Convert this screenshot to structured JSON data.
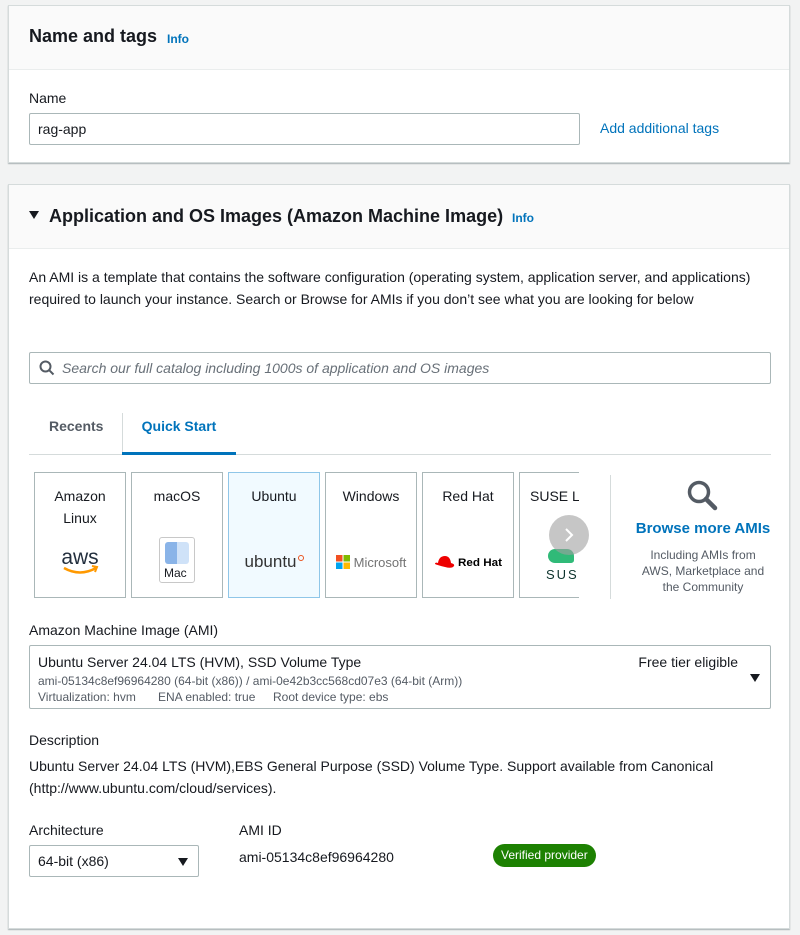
{
  "name_tags": {
    "title": "Name and tags",
    "info": "Info",
    "name_label": "Name",
    "name_value": "rag-app",
    "add_tags": "Add additional tags"
  },
  "ami_section": {
    "title": "Application and OS Images (Amazon Machine Image)",
    "info": "Info",
    "description": "An AMI is a template that contains the software configuration (operating system, application server, and applications) required to launch your instance. Search or Browse for AMIs if you don’t see what you are looking for below",
    "search_placeholder": "Search our full catalog including 1000s of application and OS images",
    "tabs": [
      "Recents",
      "Quick Start"
    ],
    "active_tab": "Quick Start",
    "os_cards": [
      {
        "label": "Amazon Linux",
        "logo": "aws"
      },
      {
        "label": "macOS",
        "logo": "Mac"
      },
      {
        "label": "Ubuntu",
        "logo": "ubuntu",
        "selected": true
      },
      {
        "label": "Windows",
        "logo": "Microsoft"
      },
      {
        "label": "Red Hat",
        "logo": "Red Hat"
      },
      {
        "label": "SUSE Li",
        "logo": "SUSE"
      }
    ],
    "browse_more": {
      "title": "Browse more AMIs",
      "subtitle": "Including AMIs from AWS, Marketplace and the Community"
    },
    "ami_label": "Amazon Machine Image (AMI)",
    "ami_select": {
      "name": "Ubuntu Server 24.04 LTS (HVM), SSD Volume Type",
      "free_tier": "Free tier eligible",
      "ids": "ami-05134c8ef96964280 (64-bit (x86)) / ami-0e42b3cc568cd07e3 (64-bit (Arm))",
      "virtualization": "Virtualization: hvm",
      "ena": "ENA enabled: true",
      "root_device": "Root device type: ebs"
    },
    "description_label": "Description",
    "description_text": "Ubuntu Server 24.04 LTS (HVM),EBS General Purpose (SSD) Volume Type. Support available from Canonical (http://www.ubuntu.com/cloud/services).",
    "architecture_label": "Architecture",
    "architecture_value": "64-bit (x86)",
    "ami_id_label": "AMI ID",
    "ami_id_value": "ami-05134c8ef96964280",
    "verified_badge": "Verified provider"
  },
  "colors": {
    "link": "#0073bb",
    "selected_bg": "#f1faff",
    "verified_green": "#1d8102",
    "redhat": "#ee0000",
    "suse_green": "#30ba78",
    "ubuntu_orange": "#e95420"
  }
}
